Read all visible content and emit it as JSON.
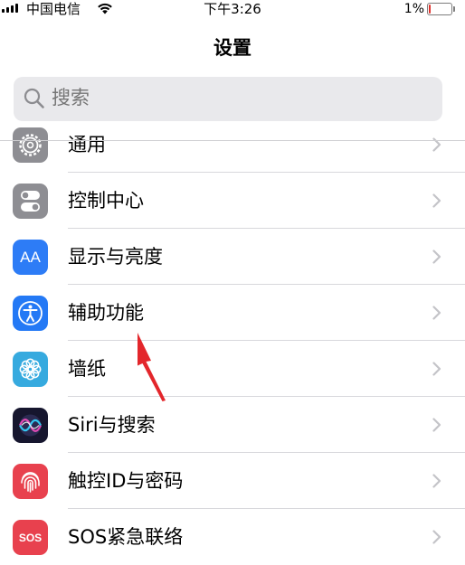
{
  "status_bar": {
    "carrier": "中国电信",
    "time": "下午3:26",
    "battery_percent": "1%",
    "battery_level": 0.01
  },
  "nav": {
    "title": "设置"
  },
  "search": {
    "placeholder": "搜索"
  },
  "settings_items": [
    {
      "label": "通用",
      "icon": "gear-icon",
      "color": "#8e8e93"
    },
    {
      "label": "控制中心",
      "icon": "toggles-icon",
      "color": "#8e8e93"
    },
    {
      "label": "显示与亮度",
      "icon": "text-size-icon",
      "color": "#2d7cf6",
      "icon_text": "AA"
    },
    {
      "label": "辅助功能",
      "icon": "accessibility-icon",
      "color": "#2479f5"
    },
    {
      "label": "墙纸",
      "icon": "flower-icon",
      "color": "#36aadf"
    },
    {
      "label": "Siri与搜索",
      "icon": "siri-icon",
      "color": "#1c1c3c"
    },
    {
      "label": "触控ID与密码",
      "icon": "fingerprint-icon",
      "color": "#e8414e"
    },
    {
      "label": "SOS紧急联络",
      "icon": "sos-icon",
      "color": "#e8414e",
      "icon_text": "SOS"
    }
  ],
  "annotation": {
    "arrow_color": "#e3262b"
  }
}
